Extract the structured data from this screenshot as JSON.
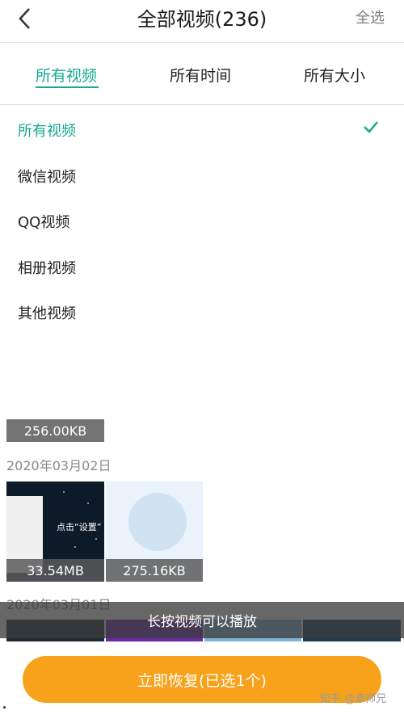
{
  "header": {
    "title": "全部视频(236)",
    "select_all": "全选"
  },
  "tabs": [
    {
      "label": "所有视频",
      "active": true
    },
    {
      "label": "所有时间",
      "active": false
    },
    {
      "label": "所有大小",
      "active": false
    }
  ],
  "filter_options": [
    {
      "label": "所有视频",
      "selected": true
    },
    {
      "label": "微信视频",
      "selected": false
    },
    {
      "label": "QQ视频",
      "selected": false
    },
    {
      "label": "相册视频",
      "selected": false
    },
    {
      "label": "其他视频",
      "selected": false
    }
  ],
  "prev_item": {
    "size": "256.00KB"
  },
  "groups": [
    {
      "date": "2020年03月02日",
      "items": [
        {
          "size": "33.54MB",
          "overlay": "点击“设置”"
        },
        {
          "size": "275.16KB"
        }
      ]
    },
    {
      "date": "2020年03月01日"
    }
  ],
  "toast": "长按视频可以播放",
  "restore_button": "立即恢复(已选1个)",
  "watermark": "知乎 @卓师兄",
  "colors": {
    "accent": "#17a98f",
    "button": "#f7a21a"
  }
}
